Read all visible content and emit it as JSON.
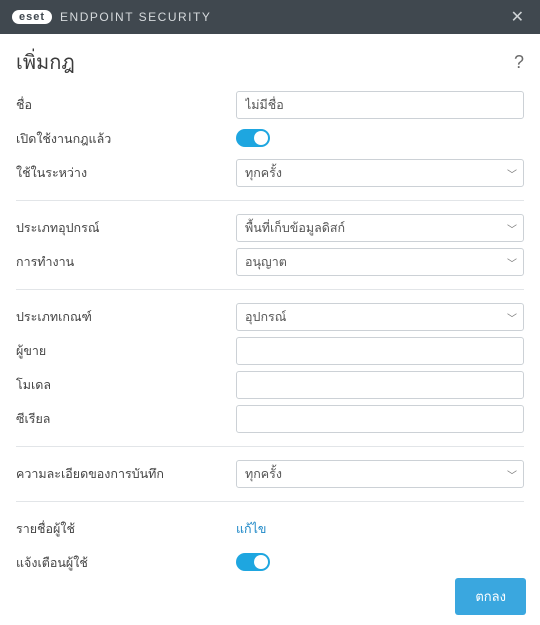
{
  "titlebar": {
    "logo": "eset",
    "product": "ENDPOINT SECURITY"
  },
  "page": {
    "title": "เพิ่มกฎ"
  },
  "fields": {
    "name_label": "ชื่อ",
    "name_value": "ไม่มีชื่อ",
    "enabled_label": "เปิดใช้งานกฎแล้ว",
    "apply_during_label": "ใช้ในระหว่าง",
    "apply_during_value": "ทุกครั้ง",
    "device_type_label": "ประเภทอุปกรณ์",
    "device_type_value": "พื้นที่เก็บข้อมูลดิสก์",
    "action_label": "การทำงาน",
    "action_value": "อนุญาต",
    "criteria_type_label": "ประเภทเกณฑ์",
    "criteria_type_value": "อุปกรณ์",
    "vendor_label": "ผู้ขาย",
    "model_label": "โมเดล",
    "serial_label": "ซีเรียล",
    "log_severity_label": "ความละเอียดของการบันทึก",
    "log_severity_value": "ทุกครั้ง",
    "user_list_label": "รายชื่อผู้ใช้",
    "user_list_link": "แก้ไข",
    "notify_user_label": "แจ้งเตือนผู้ใช้"
  },
  "footer": {
    "ok": "ตกลง"
  }
}
